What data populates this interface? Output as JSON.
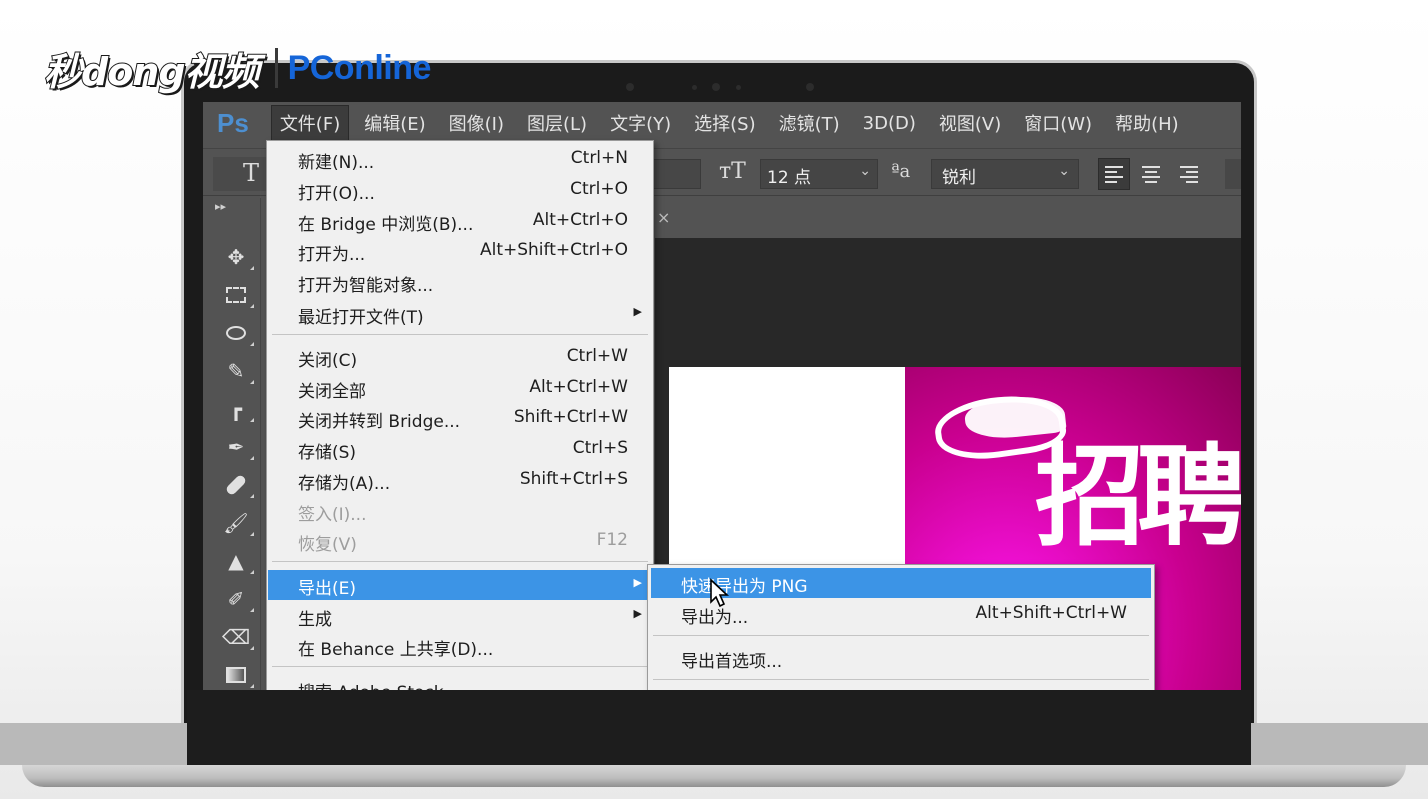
{
  "watermark": {
    "left_brand": "秒dong视频",
    "right_brand": "PConline"
  },
  "app": {
    "logo": "Ps"
  },
  "menubar": {
    "items": [
      "文件(F)",
      "编辑(E)",
      "图像(I)",
      "图层(L)",
      "文字(Y)",
      "选择(S)",
      "滤镜(T)",
      "3D(D)",
      "视图(V)",
      "窗口(W)",
      "帮助(H)"
    ],
    "active": "文件(F)"
  },
  "options_bar": {
    "tool_glyph": "T",
    "font_size_glyph": "тT",
    "font_size": "12 点",
    "antialias_glyph": "ªa",
    "antialias": "锐利",
    "align": [
      "left",
      "center",
      "right"
    ],
    "align_selected": "left"
  },
  "toolbar": {
    "tools": [
      "move-tool",
      "marquee-tool",
      "lasso-tool",
      "quick-select-tool",
      "crop-tool",
      "eyedropper-tool",
      "healing-brush-tool",
      "brush-tool",
      "clone-stamp-tool",
      "history-brush-tool",
      "eraser-tool",
      "gradient-tool"
    ]
  },
  "document": {
    "tab_close": "×",
    "canvas_text": "招聘"
  },
  "file_menu": {
    "items": [
      {
        "label": "新建(N)...",
        "shortcut": "Ctrl+N"
      },
      {
        "label": "打开(O)...",
        "shortcut": "Ctrl+O"
      },
      {
        "label": "在 Bridge 中浏览(B)...",
        "shortcut": "Alt+Ctrl+O"
      },
      {
        "label": "打开为...",
        "shortcut": "Alt+Shift+Ctrl+O"
      },
      {
        "label": "打开为智能对象...",
        "shortcut": ""
      },
      {
        "label": "最近打开文件(T)",
        "shortcut": "",
        "submenu": true
      },
      {
        "label": "关闭(C)",
        "shortcut": "Ctrl+W"
      },
      {
        "label": "关闭全部",
        "shortcut": "Alt+Ctrl+W"
      },
      {
        "label": "关闭并转到 Bridge...",
        "shortcut": "Shift+Ctrl+W"
      },
      {
        "label": "存储(S)",
        "shortcut": "Ctrl+S"
      },
      {
        "label": "存储为(A)...",
        "shortcut": "Shift+Ctrl+S"
      },
      {
        "label": "签入(I)...",
        "shortcut": "",
        "disabled": true
      },
      {
        "label": "恢复(V)",
        "shortcut": "F12",
        "disabled": true
      },
      {
        "label": "导出(E)",
        "shortcut": "",
        "submenu": true,
        "highlighted": true
      },
      {
        "label": "生成",
        "shortcut": "",
        "submenu": true
      },
      {
        "label": "在 Behance 上共享(D)...",
        "shortcut": ""
      },
      {
        "label": "搜索 Adobe Stock...",
        "shortcut": ""
      }
    ]
  },
  "export_submenu": {
    "items": [
      {
        "label": "快速导出为 PNG",
        "shortcut": "",
        "highlighted": true
      },
      {
        "label": "导出为...",
        "shortcut": "Alt+Shift+Ctrl+W"
      },
      {
        "label": "导出首选项...",
        "shortcut": ""
      }
    ]
  },
  "colors": {
    "highlight": "#3c94e6",
    "canvas_magenta": "#c9008f",
    "ps_blue": "#4d8fd0",
    "pconline_blue": "#1565d8"
  }
}
